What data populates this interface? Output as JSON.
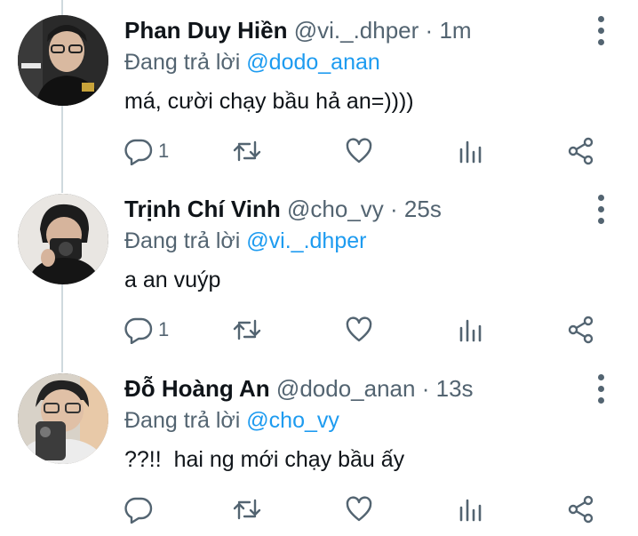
{
  "tweets": [
    {
      "name": "Phan Duy Hiền",
      "handle": "@vi._.dhper",
      "time": "1m",
      "replying_prefix": "Đang trả lời ",
      "replying_to": "@dodo_anan",
      "text": "má, cười chạy bầu hả an=))))",
      "reply_count": "1"
    },
    {
      "name": "Trịnh Chí Vinh",
      "handle": "@cho_vy",
      "time": "25s",
      "replying_prefix": "Đang trả lời ",
      "replying_to": "@vi._.dhper",
      "text": "a an vuýp",
      "reply_count": "1"
    },
    {
      "name": "Đỗ Hoàng An",
      "handle": "@dodo_anan",
      "time": "13s",
      "replying_prefix": "Đang trả lời ",
      "replying_to": "@cho_vy",
      "text": "??!!  hai ng mới chạy bầu ấy",
      "reply_count": ""
    }
  ],
  "meta_separator": "·",
  "icons": [
    "more-vertical-icon",
    "reply-icon",
    "retweet-icon",
    "like-icon",
    "analytics-icon",
    "share-icon"
  ],
  "colors": {
    "accent": "#1d9bf0",
    "secondary_text": "#536471",
    "primary_text": "#0f1419",
    "thread_line": "#cfd9de"
  }
}
